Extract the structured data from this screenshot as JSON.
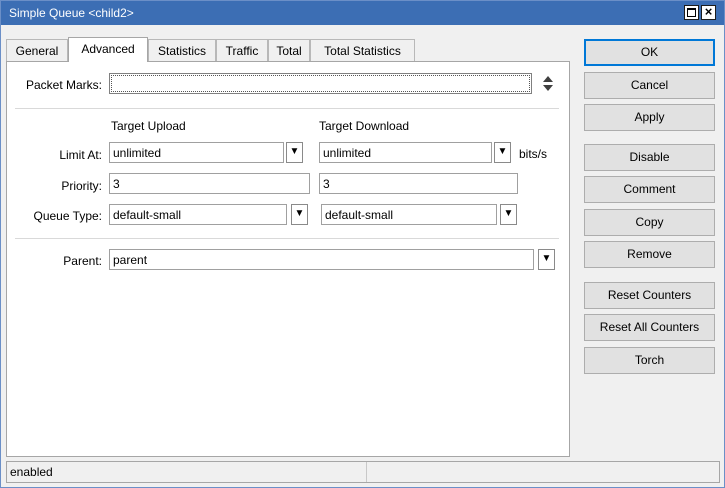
{
  "window": {
    "title": "Simple Queue <child2>"
  },
  "tabs": [
    {
      "label": "General"
    },
    {
      "label": "Advanced"
    },
    {
      "label": "Statistics"
    },
    {
      "label": "Traffic"
    },
    {
      "label": "Total"
    },
    {
      "label": "Total Statistics"
    }
  ],
  "active_tab": "Advanced",
  "form": {
    "packet_marks": {
      "label": "Packet Marks:",
      "value": ""
    },
    "target_upload_header": "Target Upload",
    "target_download_header": "Target Download",
    "limit_at": {
      "label": "Limit At:",
      "upload": "unlimited",
      "download": "unlimited",
      "unit": "bits/s"
    },
    "priority": {
      "label": "Priority:",
      "upload": "3",
      "download": "3"
    },
    "queue_type": {
      "label": "Queue Type:",
      "upload": "default-small",
      "download": "default-small"
    },
    "parent": {
      "label": "Parent:",
      "value": "parent"
    }
  },
  "buttons": {
    "ok": "OK",
    "cancel": "Cancel",
    "apply": "Apply",
    "disable": "Disable",
    "comment": "Comment",
    "copy": "Copy",
    "remove": "Remove",
    "reset_counters": "Reset Counters",
    "reset_all_counters": "Reset All Counters",
    "torch": "Torch"
  },
  "status": {
    "text": "enabled"
  },
  "icons": {
    "dropdown": "dropdown-arrow-icon",
    "updown": "up-down-arrows-icon",
    "maximize": "maximize-icon",
    "close": "close-icon"
  },
  "colors": {
    "titlebar": "#3c6eb4",
    "ok_border": "#0078d7",
    "button_bg": "#e1e1e1"
  }
}
